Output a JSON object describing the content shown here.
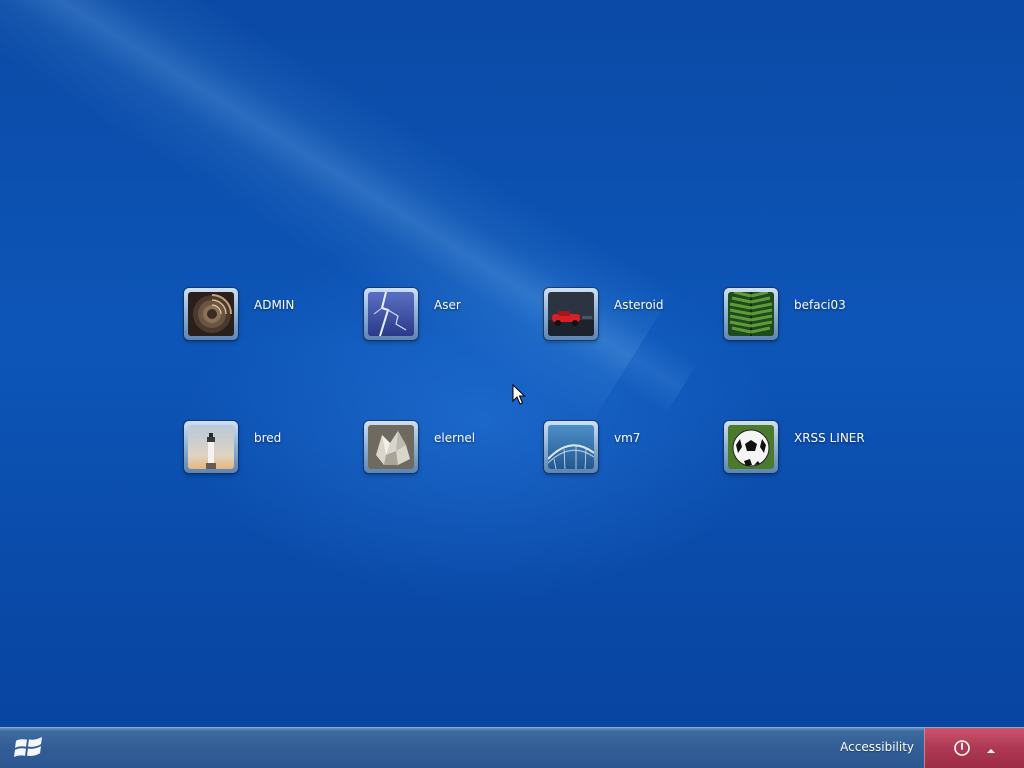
{
  "screen": {
    "type": "logon-screen",
    "background_color": "#0b4aa6"
  },
  "users": [
    {
      "name": "ADMIN",
      "picture": "spiral-staircase-icon"
    },
    {
      "name": "Aser",
      "picture": "lightning-icon"
    },
    {
      "name": "Asteroid",
      "picture": "red-car-icon"
    },
    {
      "name": "befaci03",
      "picture": "green-leaf-icon"
    },
    {
      "name": "bred",
      "picture": "lighthouse-icon"
    },
    {
      "name": "elernel",
      "picture": "crystals-icon"
    },
    {
      "name": "vm7",
      "picture": "bridge-icon"
    },
    {
      "name": "XRSS LINER",
      "picture": "soccer-ball-icon"
    }
  ],
  "taskbar": {
    "start_logo": "windows-logo-icon",
    "accessibility_label": "Accessibility",
    "power_button": "power-icon",
    "power_options": "up-arrow-icon",
    "power_area_color": "#b03a55"
  }
}
